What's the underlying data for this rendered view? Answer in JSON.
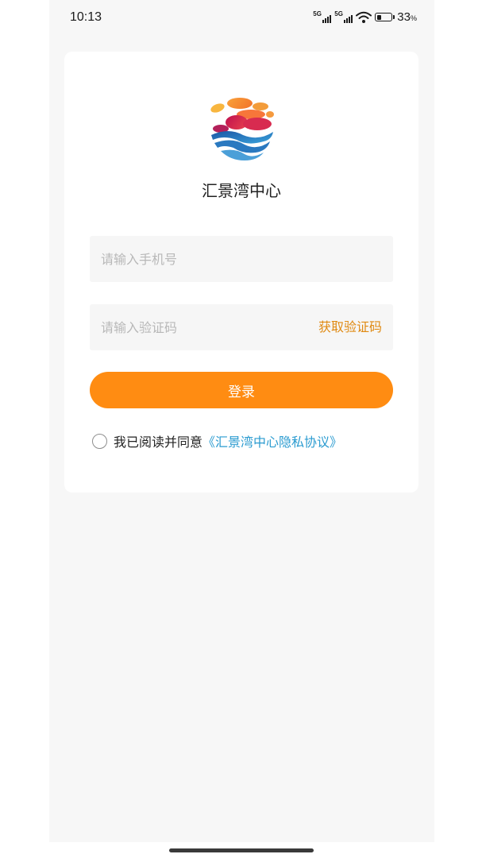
{
  "status_bar": {
    "time": "10:13",
    "signal_label_1": "5G",
    "signal_label_2": "5G",
    "battery_level": 0.33,
    "battery_percent": "33",
    "battery_unit": "%"
  },
  "login": {
    "brand_name": "汇景湾中心",
    "phone_placeholder": "请输入手机号",
    "code_placeholder": "请输入验证码",
    "get_code_label": "获取验证码",
    "login_label": "登录",
    "agreement_prefix": "我已阅读并同意",
    "agreement_link": "《汇景湾中心隐私协议》"
  },
  "icons": {
    "logo": "brand-logo-icon",
    "checkbox": "agreement-radio-icon",
    "wifi": "wifi-icon",
    "battery": "battery-icon"
  },
  "colors": {
    "accent": "#ff8c12",
    "get_code": "#e08a12",
    "link": "#2a9bd0",
    "background": "#f7f7f7"
  }
}
